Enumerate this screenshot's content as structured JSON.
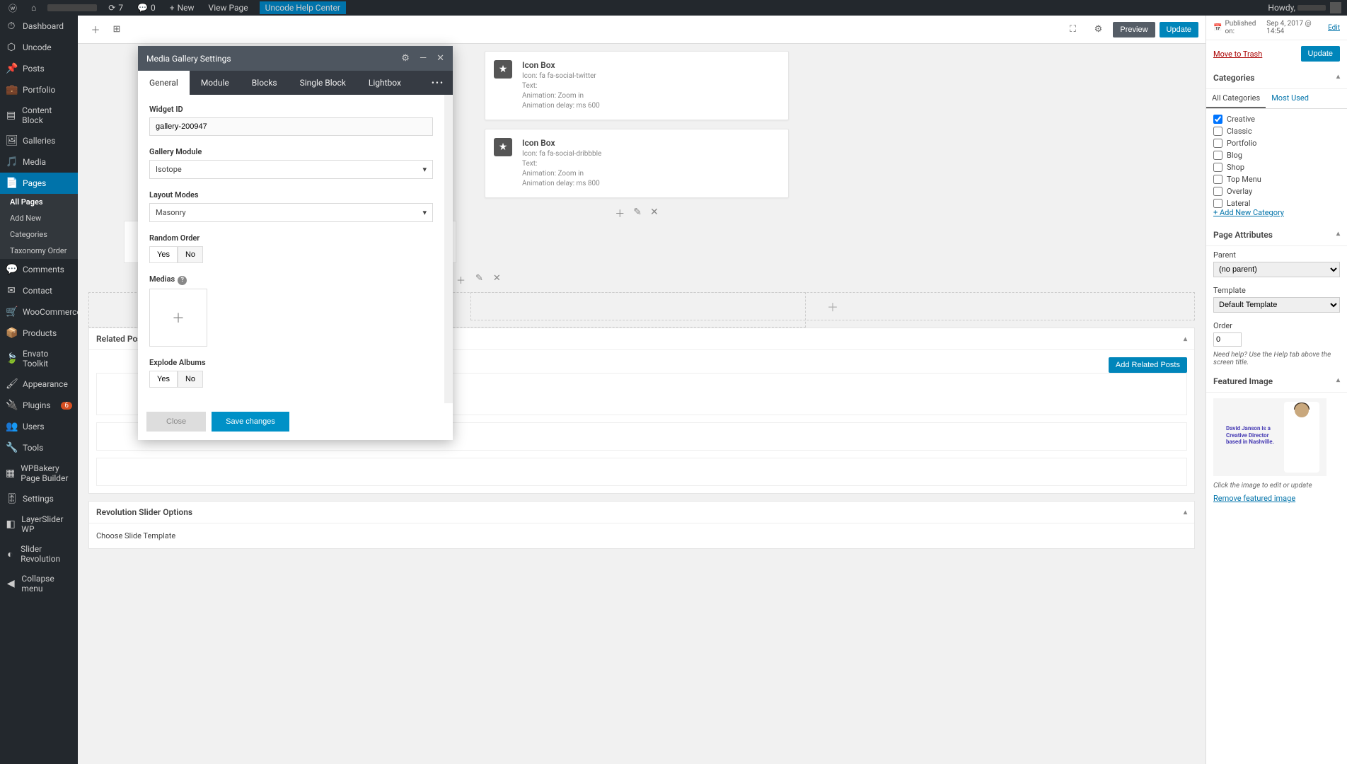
{
  "adminbar": {
    "updates": "7",
    "comments": "0",
    "new": "New",
    "view_page": "View Page",
    "help_center": "Uncode Help Center",
    "howdy": "Howdy,"
  },
  "sidebar": {
    "items": [
      {
        "icon": "◫",
        "label": "Dashboard"
      },
      {
        "icon": "⬡",
        "label": "Uncode"
      },
      {
        "icon": "✎",
        "label": "Posts"
      },
      {
        "icon": "📁",
        "label": "Portfolio"
      },
      {
        "icon": "▤",
        "label": "Content Block"
      },
      {
        "icon": "🖼",
        "label": "Galleries"
      },
      {
        "icon": "🎵",
        "label": "Media"
      },
      {
        "icon": "📄",
        "label": "Pages",
        "current": true
      },
      {
        "icon": "💬",
        "label": "Comments"
      },
      {
        "icon": "👤",
        "label": "Contact"
      },
      {
        "icon": "🛒",
        "label": "WooCommerce"
      },
      {
        "icon": "📦",
        "label": "Products"
      },
      {
        "icon": "🍃",
        "label": "Envato Toolkit"
      },
      {
        "icon": "🖌",
        "label": "Appearance"
      },
      {
        "icon": "🔌",
        "label": "Plugins",
        "badge": "6"
      },
      {
        "icon": "👥",
        "label": "Users"
      },
      {
        "icon": "🔧",
        "label": "Tools"
      },
      {
        "icon": "▦",
        "label": "WPBakery Page Builder"
      },
      {
        "icon": "⚙",
        "label": "Settings"
      },
      {
        "icon": "◧",
        "label": "LayerSlider WP"
      },
      {
        "icon": "◐",
        "label": "Slider Revolution"
      },
      {
        "icon": "◀",
        "label": "Collapse menu"
      }
    ],
    "submenu": [
      "All Pages",
      "Add New",
      "Categories",
      "Taxonomy Order"
    ]
  },
  "toolbar": {
    "preview": "Preview",
    "update": "Update"
  },
  "iconboxes": [
    {
      "title": "Icon Box",
      "icon": "Icon: fa fa-social-twitter",
      "text": "Text:",
      "anim": "Animation: Zoom in",
      "delay": "Animation delay: ms 600"
    },
    {
      "title": "Icon Box",
      "icon": "Icon: fa fa-social-dribbble",
      "text": "Text:",
      "anim": "Animation: Zoom in",
      "delay": "Animation delay: ms 800"
    }
  ],
  "panels": {
    "related": "Related Posts",
    "add_related": "Add Related Posts",
    "revslider": "Revolution Slider Options",
    "choose_slide": "Choose Slide Template"
  },
  "meta": {
    "published_pre": "Published on:",
    "published_date": "Sep 4, 2017 @ 14:54",
    "edit": "Edit",
    "trash": "Move to Trash",
    "update": "Update"
  },
  "categories": {
    "title": "Categories",
    "tab_all": "All Categories",
    "tab_most": "Most Used",
    "items": [
      "Creative",
      "Classic",
      "Portfolio",
      "Blog",
      "Shop",
      "Top Menu",
      "Overlay",
      "Lateral"
    ],
    "checked": [
      0
    ],
    "add_new": "+ Add New Category"
  },
  "page_attrs": {
    "title": "Page Attributes",
    "parent_label": "Parent",
    "parent_value": "(no parent)",
    "template_label": "Template",
    "template_value": "Default Template",
    "order_label": "Order",
    "order_value": "0",
    "help": "Need help? Use the Help tab above the screen title."
  },
  "featured": {
    "title": "Featured Image",
    "img_text": "David Janson is a Creative Director based in Nashville.",
    "click_hint": "Click the image to edit or update",
    "remove": "Remove featured image"
  },
  "modal": {
    "title": "Media Gallery Settings",
    "tabs": [
      "General",
      "Module",
      "Blocks",
      "Single Block",
      "Lightbox"
    ],
    "widget_id_label": "Widget ID",
    "widget_id_value": "gallery-200947",
    "gallery_module_label": "Gallery Module",
    "gallery_module_value": "Isotope",
    "layout_label": "Layout Modes",
    "layout_value": "Masonry",
    "random_label": "Random Order",
    "medias_label": "Medias",
    "explode_label": "Explode Albums",
    "yes": "Yes",
    "no": "No",
    "close": "Close",
    "save": "Save changes"
  }
}
